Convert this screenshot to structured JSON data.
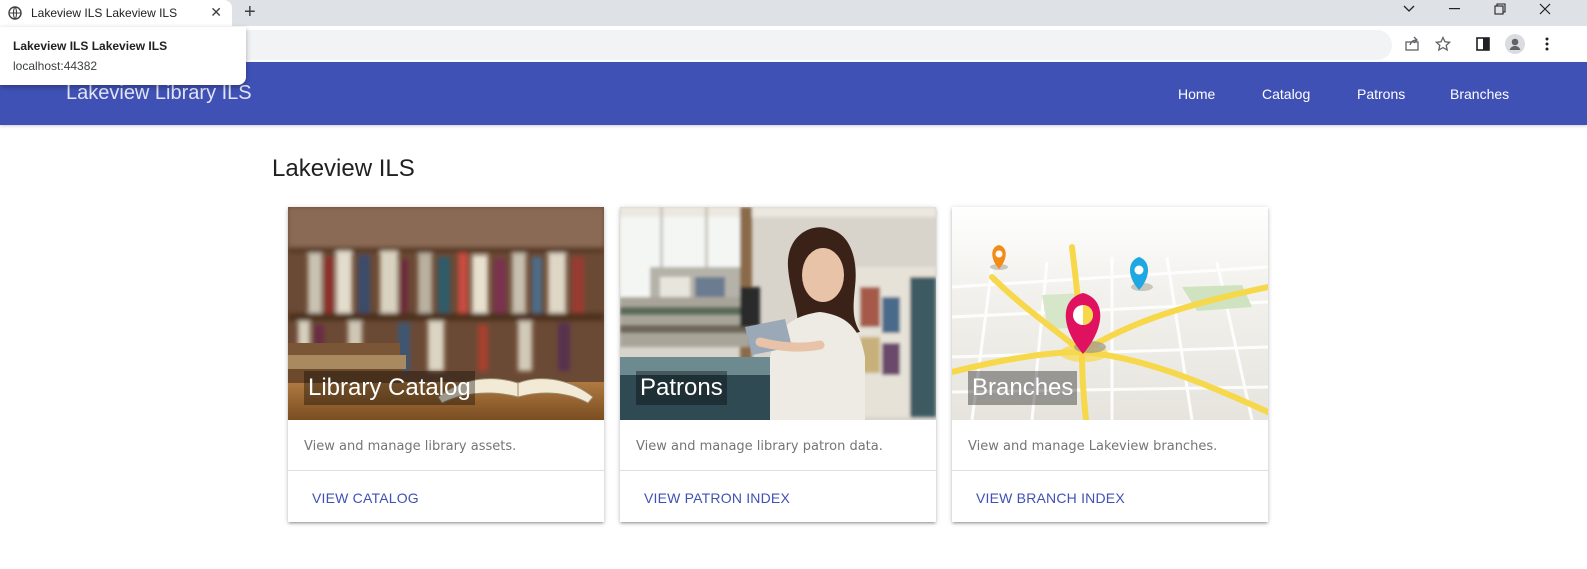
{
  "browser": {
    "tab_title": "Lakeview ILS Lakeview ILS",
    "tab_close": "✕",
    "new_tab": "+",
    "hover_card": {
      "title": "Lakeview ILS Lakeview ILS",
      "url": "localhost:44382"
    }
  },
  "navbar": {
    "brand": "Lakeview Library ILS",
    "links": [
      "Home",
      "Catalog",
      "Patrons",
      "Branches"
    ]
  },
  "main": {
    "title": "Lakeview ILS",
    "cards": [
      {
        "title": "Library Catalog",
        "text": "View and manage library assets.",
        "action": "View Catalog"
      },
      {
        "title": "Patrons",
        "text": "View and manage library patron data.",
        "action": "View Patron Index"
      },
      {
        "title": "Branches",
        "text": "View and manage Lakeview branches.",
        "action": "View Branch Index"
      }
    ]
  },
  "colors": {
    "primary": "#3f51b5",
    "pin_magenta": "#e0115f",
    "pin_blue": "#1ea7e1",
    "pin_orange": "#f28c16"
  },
  "icons": [
    "globe-icon",
    "close-icon",
    "plus-icon",
    "chevron-down-icon",
    "minimize-icon",
    "restore-icon",
    "window-close-icon",
    "share-icon",
    "star-icon",
    "side-panel-icon",
    "profile-icon",
    "kebab-menu-icon"
  ]
}
